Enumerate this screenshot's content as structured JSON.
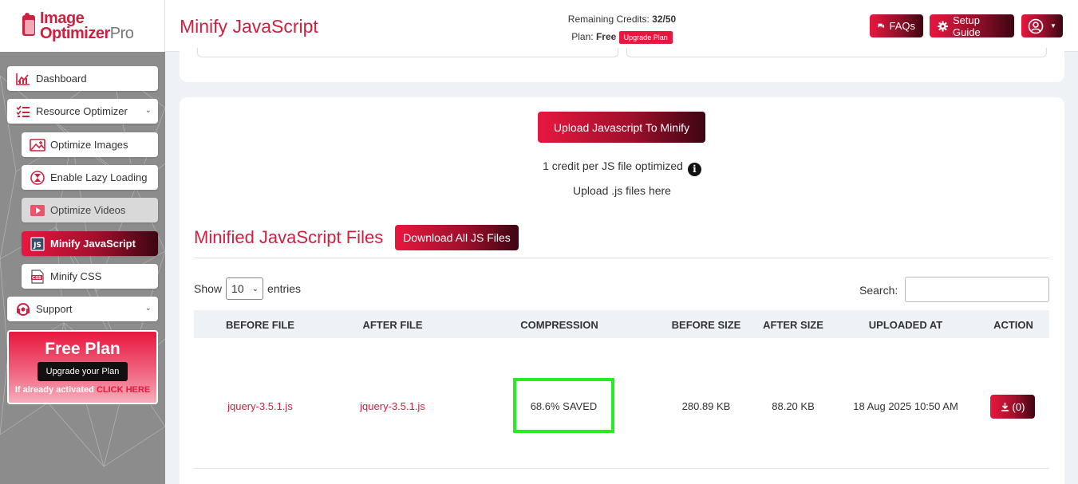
{
  "app": {
    "logo_line1": "Image",
    "logo_line2": "Optimizer",
    "logo_pro": "Pro"
  },
  "header": {
    "title": "Minify JavaScript",
    "credits_label": "Remaining Credits:",
    "credits_value": "32/50",
    "plan_label": "Plan:",
    "plan_value": "Free",
    "upgrade_label": "Upgrade Plan",
    "faqs_label": "FAQs",
    "setup_label": "Setup Guide"
  },
  "sidebar": {
    "items": [
      {
        "label": "Dashboard",
        "icon": "chart-icon"
      },
      {
        "label": "Resource Optimizer",
        "icon": "checklist-icon"
      },
      {
        "label": "Optimize Images",
        "icon": "image-icon"
      },
      {
        "label": "Enable Lazy Loading",
        "icon": "lazy-loading-icon"
      },
      {
        "label": "Optimize Videos",
        "icon": "video-icon"
      },
      {
        "label": "Minify JavaScript",
        "icon": "js-file-icon"
      },
      {
        "label": "Minify CSS",
        "icon": "css-file-icon"
      },
      {
        "label": "Support",
        "icon": "headset-icon"
      }
    ],
    "free_plan": {
      "title": "Free Plan",
      "button": "Upgrade your Plan",
      "note": "If already activated",
      "click": "CLICK HERE"
    }
  },
  "upload": {
    "button": "Upload Javascript To Minify",
    "credit_note": "1 credit per JS file optimized",
    "hint": "Upload .js files here"
  },
  "files": {
    "title": "Minified JavaScript Files",
    "download_all": "Download All JS Files",
    "show_label": "Show",
    "entries_value": "10",
    "entries_label": "entries",
    "search_label": "Search:",
    "columns": [
      "BEFORE FILE",
      "AFTER FILE",
      "COMPRESSION",
      "BEFORE SIZE",
      "AFTER SIZE",
      "UPLOADED AT",
      "ACTION"
    ],
    "rows": [
      {
        "before_file": "jquery-3.5.1.js",
        "after_file": "jquery-3.5.1.js",
        "compression": "68.6% SAVED",
        "before_size": "280.89 KB",
        "after_size": "88.20 KB",
        "uploaded_at": "18 Aug 2025 10:50 AM",
        "action": "(0)"
      }
    ]
  },
  "colors": {
    "brand": "#d0203f",
    "accent": "#e8173f",
    "highlight": "#22ee22"
  }
}
